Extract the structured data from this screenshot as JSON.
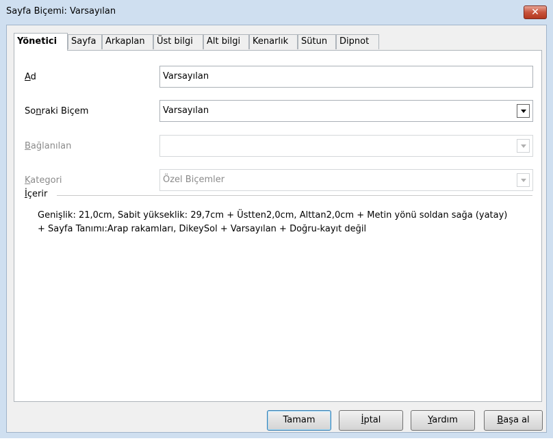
{
  "window": {
    "title": "Sayfa Biçemi: Varsayılan",
    "close_glyph": "✕"
  },
  "tabs": [
    {
      "label": "Yönetici",
      "active": true
    },
    {
      "label": "Sayfa"
    },
    {
      "label": "Arkaplan"
    },
    {
      "label": "Üst bilgi"
    },
    {
      "label": "Alt bilgi"
    },
    {
      "label": "Kenarlık"
    },
    {
      "label": "Sütun"
    },
    {
      "label": "Dipnot"
    }
  ],
  "fields": {
    "name": {
      "label_pre": "",
      "label_u": "A",
      "label_post": "d",
      "value": "Varsayılan"
    },
    "next_style": {
      "label_pre": "So",
      "label_u": "n",
      "label_post": "raki Biçem",
      "value": "Varsayılan"
    },
    "linked": {
      "label_pre": "",
      "label_u": "B",
      "label_post": "ağlanılan",
      "value": ""
    },
    "category": {
      "label_pre": "",
      "label_u": "K",
      "label_post": "ategori",
      "value": "Özel Biçemler"
    }
  },
  "contains": {
    "label_pre": "",
    "label_u": "İ",
    "label_post": "çerir",
    "text": "Genişlik: 21,0cm, Sabit yükseklik: 29,7cm + Üstten2,0cm, Alttan2,0cm + Metin yönü soldan sağa (yatay) + Sayfa Tanımı:Arap rakamları, DikeySol + Varsayılan + Doğru-kayıt değil"
  },
  "buttons": {
    "ok": {
      "pre": "",
      "u": "",
      "post": "Tamam"
    },
    "cancel": {
      "pre": "",
      "u": "İ",
      "post": "ptal"
    },
    "help": {
      "pre": "",
      "u": "Y",
      "post": "ardım"
    },
    "reset": {
      "pre": "",
      "u": "B",
      "post": "aşa al"
    }
  },
  "colors": {
    "frame": "#cfdff0",
    "close_red": "#c8533c",
    "default_button_border": "#3c7fb1"
  }
}
